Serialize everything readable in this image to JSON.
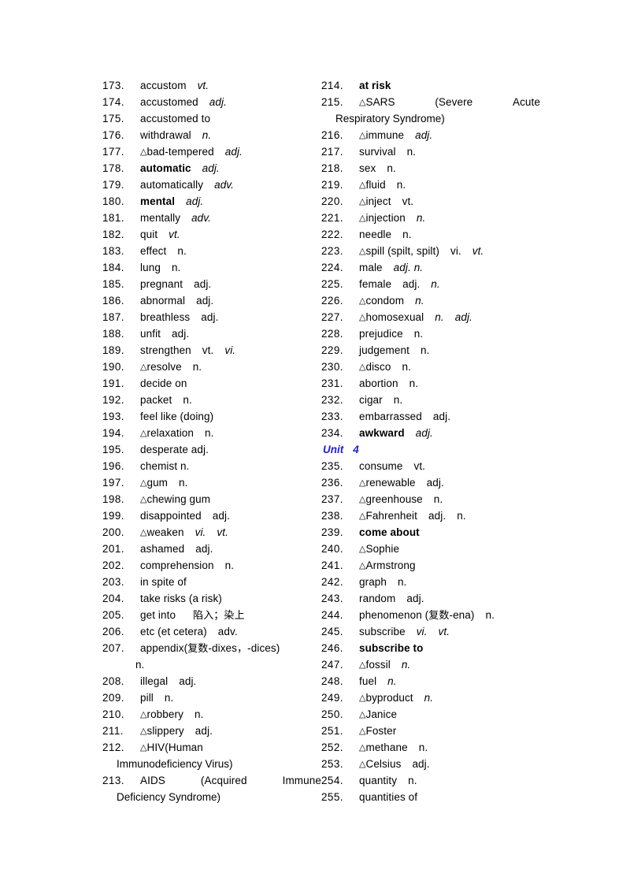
{
  "document": {
    "type": "vocabulary-list",
    "unit_heading": {
      "label": "Unit",
      "number": "4",
      "color": "#2222cc"
    }
  },
  "left_column": {
    "entries": [
      {
        "num": "173.",
        "word": "accustom",
        "pos": "vt.",
        "pos_italic": true
      },
      {
        "num": "174.",
        "word": "accustomed",
        "pos": "adj.",
        "pos_italic": true
      },
      {
        "num": "175.",
        "word": "accustomed to",
        "pos": ""
      },
      {
        "num": "176.",
        "word": "withdrawal",
        "pos": "n.",
        "pos_italic": true
      },
      {
        "num": "177.",
        "triangle": true,
        "word": "bad-tempered",
        "pos": "adj.",
        "pos_italic": true
      },
      {
        "num": "178.",
        "word": "automatic",
        "bold": true,
        "pos": "adj.",
        "pos_italic": true
      },
      {
        "num": "179.",
        "word": "automatically",
        "pos": "adv.",
        "pos_italic": true
      },
      {
        "num": "180.",
        "word": "mental",
        "bold": true,
        "pos": "adj.",
        "pos_italic": true
      },
      {
        "num": "181.",
        "word": "mentally",
        "pos": "adv.",
        "pos_italic": true
      },
      {
        "num": "182.",
        "word": "quit",
        "pos": "vt.",
        "pos_italic": true
      },
      {
        "num": "183.",
        "word": "effect",
        "pos": "n.",
        "pos_italic": false
      },
      {
        "num": "184.",
        "word": "lung",
        "pos": "n.",
        "pos_italic": false
      },
      {
        "num": "185.",
        "word": "pregnant",
        "pos": "adj.",
        "pos_italic": false
      },
      {
        "num": "186.",
        "word": "abnormal",
        "pos": "adj.",
        "pos_italic": false
      },
      {
        "num": "187.",
        "word": "breathless",
        "pos": "adj.",
        "pos_italic": false
      },
      {
        "num": "188.",
        "word": "unfit",
        "pos": "adj.",
        "pos_italic": false
      },
      {
        "num": "189.",
        "word": "strengthen",
        "pos": "vt.",
        "pos2": "vi.",
        "pos_italic": false,
        "pos2_italic": true
      },
      {
        "num": "190.",
        "triangle": true,
        "word": "resolve",
        "pos": "n.",
        "pos_italic": false
      },
      {
        "num": "191.",
        "word": "decide on",
        "pos": ""
      },
      {
        "num": "192.",
        "word": "packet",
        "pos": "n.",
        "pos_italic": false
      },
      {
        "num": "193.",
        "word": "feel like (doing)",
        "pos": ""
      },
      {
        "num": "194.",
        "triangle": true,
        "word": "relaxation",
        "pos": "n.",
        "pos_italic": false
      },
      {
        "num": "195.",
        "word": "desperate adj.",
        "pos": ""
      },
      {
        "num": "196.",
        "word": "chemist n.",
        "pos": ""
      },
      {
        "num": "197.",
        "triangle": true,
        "word": "gum",
        "pos": "n.",
        "pos_italic": false
      },
      {
        "num": "198.",
        "triangle": true,
        "word": "chewing gum",
        "pos": ""
      },
      {
        "num": "199.",
        "word": "disappointed",
        "pos": "adj.",
        "pos_italic": false
      },
      {
        "num": "200.",
        "triangle": true,
        "word": "weaken",
        "pos": "vi.",
        "pos2": "vt.",
        "pos_italic": true,
        "pos2_italic": true
      },
      {
        "num": "201.",
        "word": "ashamed",
        "pos": "adj.",
        "pos_italic": false
      },
      {
        "num": "202.",
        "word": "comprehension",
        "pos": "n.",
        "pos_italic": false
      },
      {
        "num": "203.",
        "word": "in spite of",
        "pos": ""
      },
      {
        "num": "204.",
        "word": "take risks (a risk)",
        "pos": ""
      },
      {
        "num": "205.",
        "word": "get into",
        "gloss": "陷入；染上",
        "pos": ""
      },
      {
        "num": "206.",
        "word": "etc (et cetera)",
        "pos": "adv.",
        "pos_italic": false
      },
      {
        "num": "207.",
        "word": "appendix(复数-dixes，-dices)",
        "pos": "",
        "continuation": "n."
      },
      {
        "num": "208.",
        "word": "illegal",
        "pos": "adj.",
        "pos_italic": false
      },
      {
        "num": "209.",
        "word": "pill",
        "pos": "n.",
        "pos_italic": false
      },
      {
        "num": "210.",
        "triangle": true,
        "word": "robbery",
        "pos": "n.",
        "pos_italic": false
      },
      {
        "num": "211.",
        "triangle": true,
        "word": "slippery",
        "pos": "adj.",
        "pos_italic": false
      },
      {
        "num": "212.",
        "triangle": true,
        "word": "HIV(Human",
        "pos": "",
        "continuation": "Immunodeficiency Virus)"
      },
      {
        "num": "213.",
        "justified": true,
        "parts": [
          "AIDS",
          "(Acquired",
          "Immune"
        ],
        "continuation": "Deficiency Syndrome)"
      }
    ]
  },
  "right_column": {
    "entries_before_unit": [
      {
        "num": "214.",
        "word": "at risk",
        "bold": true,
        "pos": ""
      },
      {
        "num": "215.",
        "triangle": true,
        "justified": true,
        "parts": [
          "SARS",
          "(Severe",
          "Acute"
        ],
        "continuation": "Respiratory Syndrome)"
      },
      {
        "num": "216.",
        "triangle": true,
        "word": "immune",
        "pos": "adj.",
        "pos_italic": true
      },
      {
        "num": "217.",
        "word": "survival",
        "pos": "n.",
        "pos_italic": false
      },
      {
        "num": "218.",
        "word": "sex",
        "pos": "n.",
        "pos_italic": false
      },
      {
        "num": "219.",
        "triangle": true,
        "word": "fluid",
        "pos": "n.",
        "pos_italic": false
      },
      {
        "num": "220.",
        "triangle": true,
        "word": "inject",
        "pos": "vt.",
        "pos_italic": false
      },
      {
        "num": "221.",
        "triangle": true,
        "word": "injection",
        "pos": "n.",
        "pos_italic": true
      },
      {
        "num": "222.",
        "word": "needle",
        "pos": "n.",
        "pos_italic": false
      },
      {
        "num": "223.",
        "triangle": true,
        "word": "spill  (spilt, spilt)",
        "pos": "vi.",
        "pos2": "vt.",
        "pos_italic": false,
        "pos2_italic": true
      },
      {
        "num": "224.",
        "word": "male",
        "pos": "adj. n.",
        "pos_italic": true
      },
      {
        "num": "225.",
        "word": "female",
        "pos": "adj.",
        "pos2": "n.",
        "pos_italic": false,
        "pos2_italic": true
      },
      {
        "num": "226.",
        "triangle": true,
        "word": "condom",
        "pos": "n.",
        "pos_italic": true
      },
      {
        "num": "227.",
        "triangle": true,
        "word": "homosexual",
        "pos": "n.",
        "pos2": "adj.",
        "pos_italic": true,
        "pos2_italic": true
      },
      {
        "num": "228.",
        "word": "prejudice",
        "pos": "n.",
        "pos_italic": false
      },
      {
        "num": "229.",
        "word": "judgement",
        "pos": "n.",
        "pos_italic": false
      },
      {
        "num": "230.",
        "triangle": true,
        "word": "disco",
        "pos": "n.",
        "pos_italic": false
      },
      {
        "num": "231.",
        "word": "abortion",
        "pos": "n.",
        "pos_italic": false
      },
      {
        "num": "232.",
        "word": "cigar",
        "pos": "n.",
        "pos_italic": false
      },
      {
        "num": "233.",
        "word": "embarrassed",
        "pos": "adj.",
        "pos_italic": false
      },
      {
        "num": "234.",
        "word": "awkward",
        "bold": true,
        "pos": "adj.",
        "pos_italic": true
      }
    ],
    "entries_after_unit": [
      {
        "num": "235.",
        "word": "consume",
        "pos": "vt.",
        "pos_italic": false
      },
      {
        "num": "236.",
        "triangle": true,
        "word": "renewable",
        "pos": "adj.",
        "pos_italic": false
      },
      {
        "num": "237.",
        "triangle": true,
        "word": "greenhouse",
        "pos": "n.",
        "pos_italic": false
      },
      {
        "num": "238.",
        "triangle": true,
        "word": "Fahrenheit",
        "pos": "adj.",
        "pos2": "n.",
        "pos_italic": false,
        "pos2_italic": false
      },
      {
        "num": "239.",
        "word": "come about",
        "bold": true,
        "pos": ""
      },
      {
        "num": "240.",
        "triangle": true,
        "word": "Sophie",
        "pos": ""
      },
      {
        "num": "241.",
        "triangle": true,
        "word": "Armstrong",
        "pos": ""
      },
      {
        "num": "242.",
        "word": "graph",
        "pos": "n.",
        "pos_italic": false
      },
      {
        "num": "243.",
        "word": "random",
        "pos": "adj.",
        "pos_italic": false
      },
      {
        "num": "244.",
        "word": "phenomenon (复数-ena)",
        "pos": "n.",
        "pos_italic": false
      },
      {
        "num": "245.",
        "word": "subscribe",
        "pos": "vi.",
        "pos2": "vt.",
        "pos_italic": true,
        "pos2_italic": true
      },
      {
        "num": "246.",
        "word": "subscribe to",
        "bold": true,
        "pos": ""
      },
      {
        "num": "247.",
        "triangle": true,
        "word": "fossil",
        "pos": "n.",
        "pos_italic": true
      },
      {
        "num": "248.",
        "word": "fuel",
        "pos": "n.",
        "pos_italic": true
      },
      {
        "num": "249.",
        "triangle": true,
        "word": "byproduct",
        "pos": "n.",
        "pos_italic": true
      },
      {
        "num": "250.",
        "triangle": true,
        "word": "Janice",
        "pos": ""
      },
      {
        "num": "251.",
        "triangle": true,
        "word": "Foster",
        "pos": ""
      },
      {
        "num": "252.",
        "triangle": true,
        "word": "methane",
        "pos": "n.",
        "pos_italic": false
      },
      {
        "num": "253.",
        "triangle": true,
        "word": "Celsius",
        "pos": "adj.",
        "pos_italic": false
      },
      {
        "num": "254.",
        "word": "quantity",
        "pos": "n.",
        "pos_italic": false
      },
      {
        "num": "255.",
        "word": "quantities of",
        "pos": ""
      }
    ]
  }
}
